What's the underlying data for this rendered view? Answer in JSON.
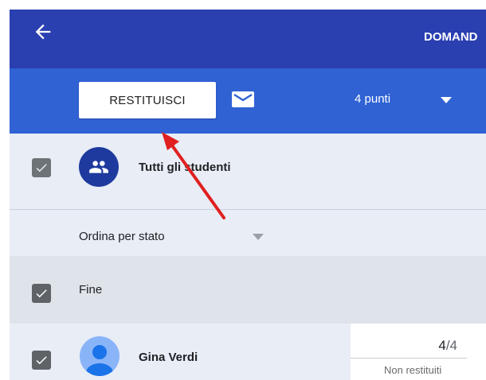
{
  "header": {
    "title": "DOMAND",
    "back_icon": "arrow-left-icon",
    "background": "#2a3fb0"
  },
  "toolbar": {
    "return_label": "RESTITUISCI",
    "mail_icon": "envelope-icon",
    "points_label": "4 punti",
    "background": "#3062d4"
  },
  "list": {
    "all_students_label": "Tutti gli studenti",
    "sort_label": "Ordina per stato",
    "group_done_label": "Fine",
    "students": [
      {
        "name": "Gina Verdi",
        "grade": "4",
        "grade_total": "/4",
        "status": "Non restituiti"
      }
    ]
  },
  "annotation": {
    "arrow_color": "#e02020"
  }
}
